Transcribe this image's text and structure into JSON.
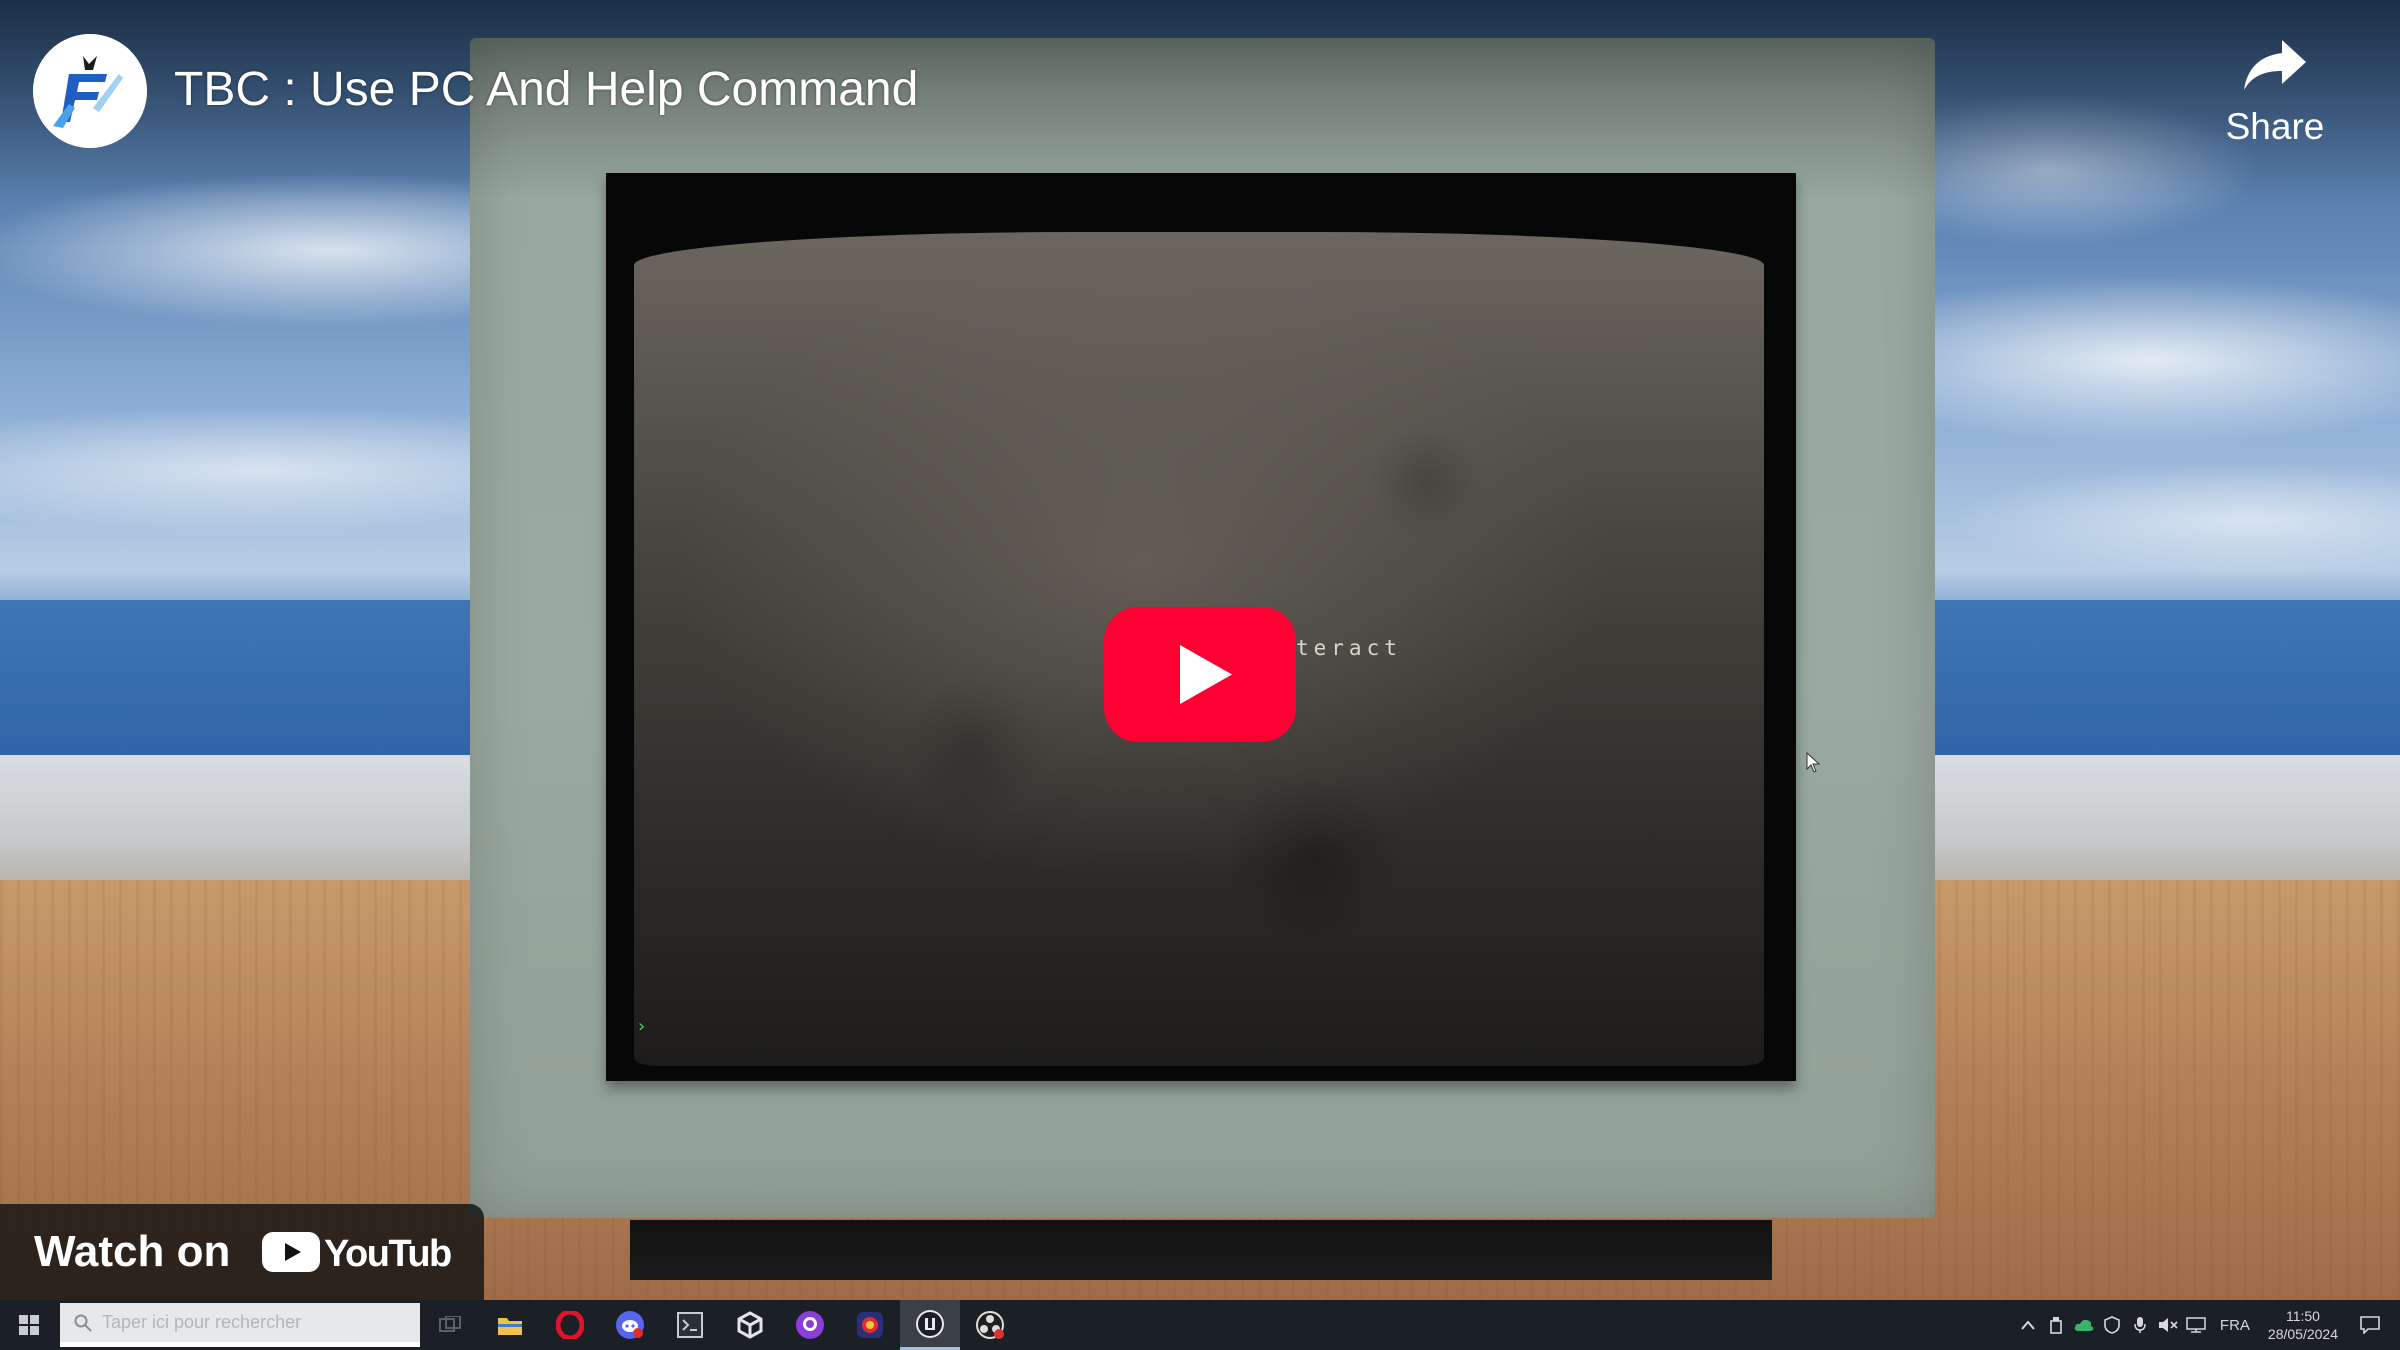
{
  "video": {
    "title": "TBC : Use PC And Help Command",
    "screen_text": "teract",
    "screen_prompt": "›"
  },
  "overlay": {
    "share_label": "Share",
    "watch_on_label": "Watch on",
    "youtube_logo_text": "YouTube",
    "play_icon": "play-icon",
    "share_icon": "share-arrow-icon"
  },
  "taskbar": {
    "search_placeholder": "Taper ici pour rechercher",
    "language": "FRA",
    "time": "11:50",
    "date": "28/05/2024",
    "apps": [
      "file-explorer-icon",
      "opera-icon",
      "discord-icon",
      "terminal-icon",
      "unity-icon",
      "github-icon",
      "game-icon",
      "unreal-icon",
      "obs-icon"
    ]
  },
  "colors": {
    "youtube_red": "#ff0033",
    "overlay_bg": "#121212",
    "taskbar_bg": "#1b1f26",
    "monitor": "#98a89e"
  }
}
